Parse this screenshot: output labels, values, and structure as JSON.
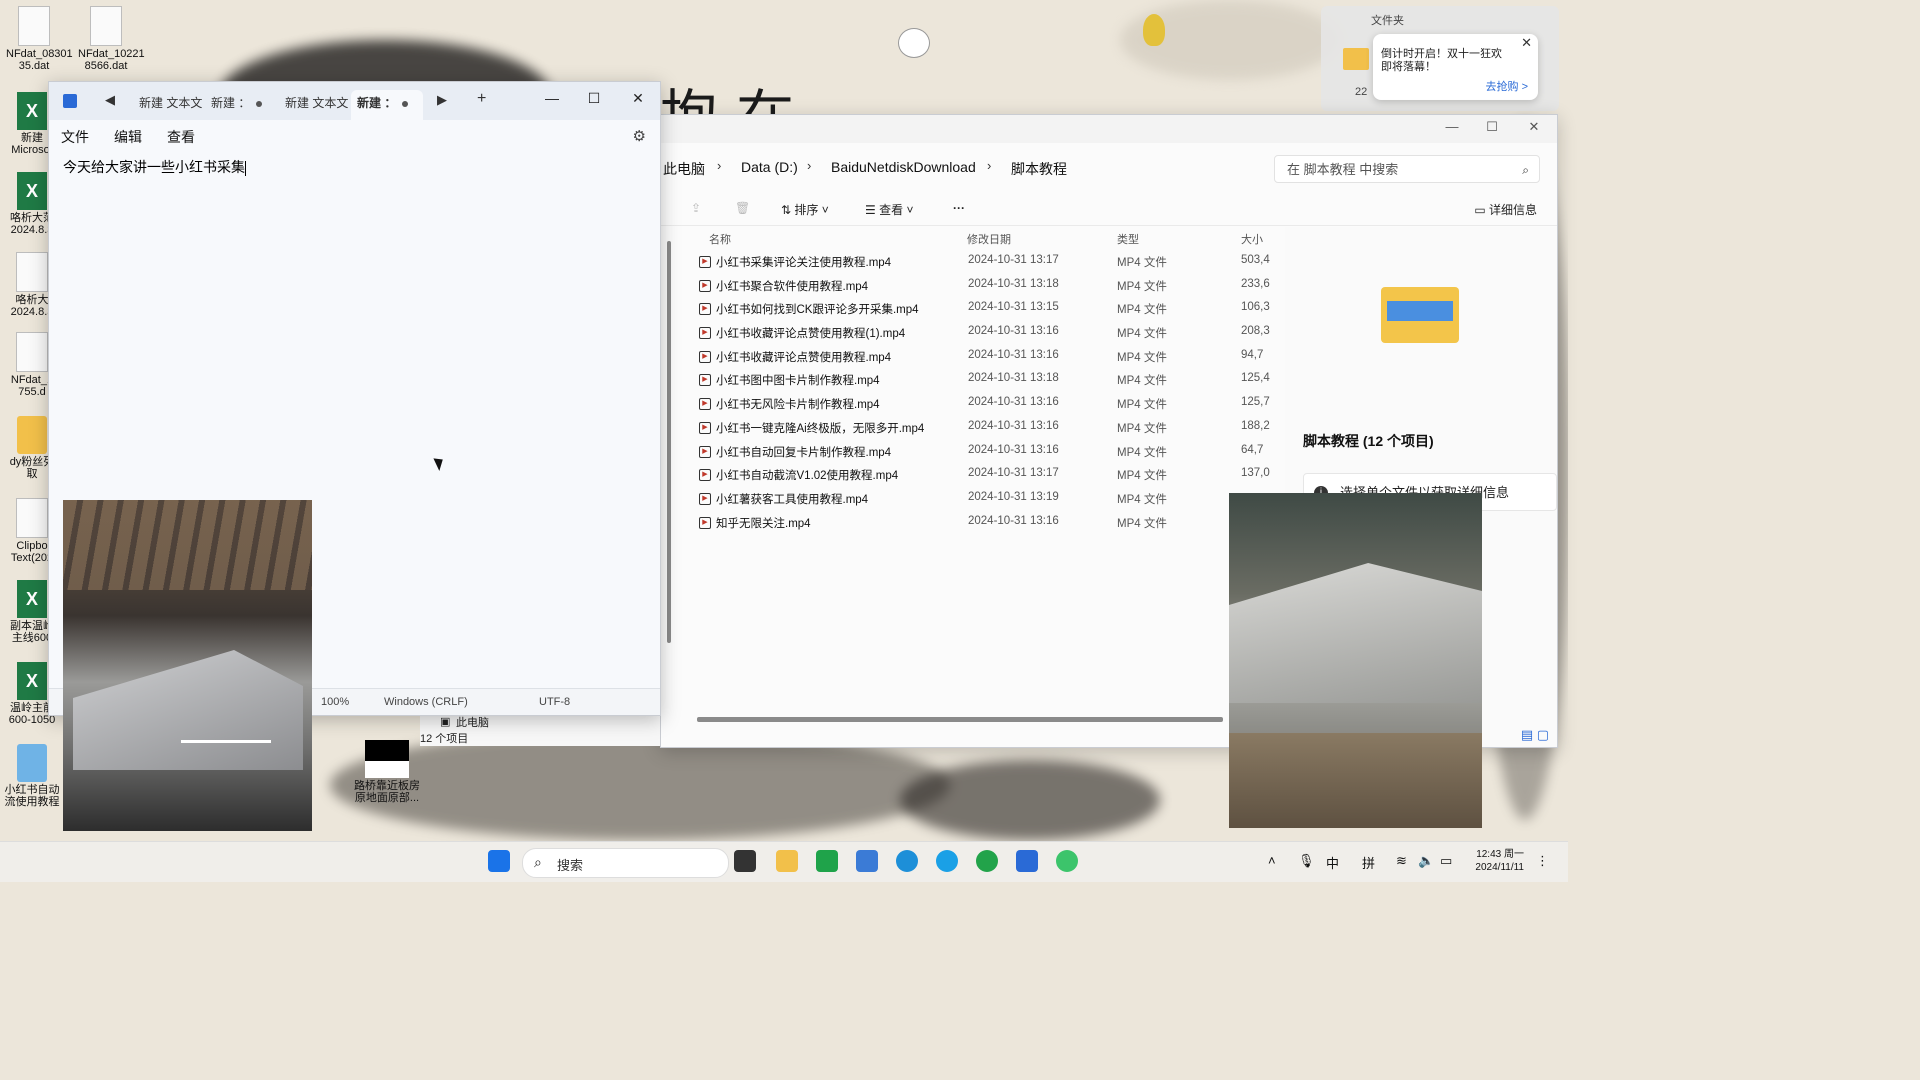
{
  "desktop": {
    "icons": [
      {
        "label": "NFdat_08301 35.dat"
      },
      {
        "label": "NFdat_10221 8566.dat"
      },
      {
        "label": "新建 Microsof"
      },
      {
        "label": "咯析大范 2024.8.3"
      },
      {
        "label": "咯析大 2024.8.3"
      },
      {
        "label": "NFdat_1 755.d"
      },
      {
        "label": "dy粉丝列 取"
      },
      {
        "label": "Clipbo Text(202"
      },
      {
        "label": "副本温岭 主线600"
      },
      {
        "label": "温岭主前 600-1050"
      },
      {
        "label": "小红书自动 流使用教程"
      },
      {
        "label": "路桥靠近板房 原地面原部..."
      }
    ]
  },
  "notepad": {
    "tabs": [
      {
        "label": "新建 文本文"
      },
      {
        "label": "新建 ："
      },
      {
        "label": "新建 文本文"
      },
      {
        "label": "新建 ："
      }
    ],
    "new_tab": "+",
    "menu": {
      "file": "文件",
      "edit": "编辑",
      "view": "查看"
    },
    "content": "今天给大家讲一些小红书采集",
    "status": {
      "zoom": "100%",
      "line_ending": "Windows (CRLF)",
      "encoding": "UTF-8"
    }
  },
  "explorer": {
    "breadcrumb": [
      "此电脑",
      "Data (D:)",
      "BaiduNetdiskDownload",
      "脚本教程"
    ],
    "search_placeholder": "在 脚本教程 中搜索",
    "toolbar": {
      "sort": "排序",
      "view": "查看",
      "more": "···",
      "details": "详细信息"
    },
    "columns": {
      "name": "名称",
      "date": "修改日期",
      "type": "类型",
      "size": "大小"
    },
    "files": [
      {
        "name": "小红书采集评论关注使用教程.mp4",
        "date": "2024-10-31 13:17",
        "type": "MP4 文件",
        "size": "503,4"
      },
      {
        "name": "小红书聚合软件使用教程.mp4",
        "date": "2024-10-31 13:18",
        "type": "MP4 文件",
        "size": "233,6"
      },
      {
        "name": "小红书如何找到CK跟评论多开采集.mp4",
        "date": "2024-10-31 13:15",
        "type": "MP4 文件",
        "size": "106,3"
      },
      {
        "name": "小红书收藏评论点赞使用教程(1).mp4",
        "date": "2024-10-31 13:16",
        "type": "MP4 文件",
        "size": "208,3"
      },
      {
        "name": "小红书收藏评论点赞使用教程.mp4",
        "date": "2024-10-31 13:16",
        "type": "MP4 文件",
        "size": "94,7"
      },
      {
        "name": "小红书图中图卡片制作教程.mp4",
        "date": "2024-10-31 13:18",
        "type": "MP4 文件",
        "size": "125,4"
      },
      {
        "name": "小红书无风险卡片制作教程.mp4",
        "date": "2024-10-31 13:16",
        "type": "MP4 文件",
        "size": "125,7"
      },
      {
        "name": "小红书一键克隆Ai终极版，无限多开.mp4",
        "date": "2024-10-31 13:16",
        "type": "MP4 文件",
        "size": "188,2"
      },
      {
        "name": "小红书自动回复卡片制作教程.mp4",
        "date": "2024-10-31 13:16",
        "type": "MP4 文件",
        "size": "64,7"
      },
      {
        "name": "小红书自动截流V1.02使用教程.mp4",
        "date": "2024-10-31 13:17",
        "type": "MP4 文件",
        "size": "137,0"
      },
      {
        "name": "小红薯获客工具使用教程.mp4",
        "date": "2024-10-31 13:19",
        "type": "MP4 文件",
        "size": ""
      },
      {
        "name": "知乎无限关注.mp4",
        "date": "2024-10-31 13:16",
        "type": "MP4 文件",
        "size": ""
      }
    ],
    "details_title": "脚本教程 (12 个项目)",
    "details_info": "选择单个文件以获取详细信息",
    "nav_this_pc": "此电脑",
    "item_count": "12 个项目"
  },
  "notification": {
    "panel_label": "文件夹",
    "message": "倒计时开启！双十一狂欢即将落幕！",
    "action": "去抢购 >",
    "bg_counter": "22"
  },
  "taskbar": {
    "search_label": "搜索",
    "ime_lang": "中",
    "ime_mode": "拼",
    "time": "12:43 周一",
    "date": "2024/11/11"
  },
  "colors": {
    "accent": "#2a6ad6",
    "excel_green": "#1f7a45",
    "folder_yellow": "#f2c04a"
  }
}
